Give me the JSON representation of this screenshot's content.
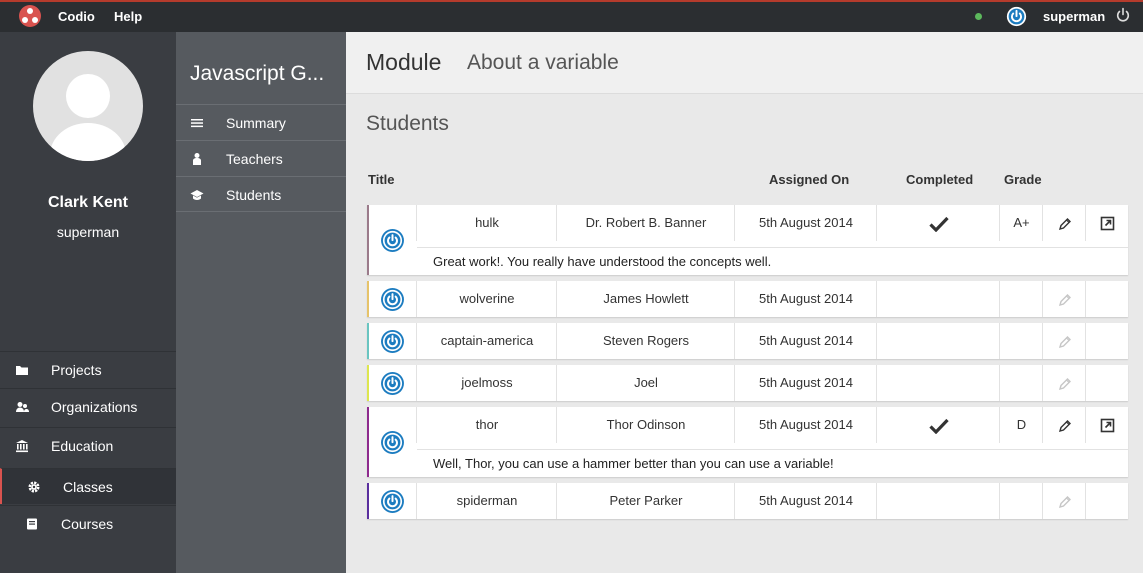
{
  "topbar": {
    "menu": [
      "Codio",
      "Help"
    ],
    "username": "superman",
    "accent": "#d9534f"
  },
  "profile": {
    "name": "Clark Kent",
    "username": "superman"
  },
  "sidebar": {
    "items": [
      {
        "label": "Projects",
        "icon": "folder-icon"
      },
      {
        "label": "Organizations",
        "icon": "users-icon"
      },
      {
        "label": "Education",
        "icon": "bank-icon"
      },
      {
        "label": "Classes",
        "icon": "gear-icon",
        "active": true
      },
      {
        "label": "Courses",
        "icon": "book-icon"
      }
    ]
  },
  "subnav": {
    "title": "Javascript G...",
    "items": [
      {
        "label": "Summary",
        "icon": "list-icon"
      },
      {
        "label": "Teachers",
        "icon": "teacher-icon"
      },
      {
        "label": "Students",
        "icon": "graduation-cap-icon"
      }
    ]
  },
  "main": {
    "module_label": "Module",
    "module_name": "About a variable",
    "section_title": "Students",
    "columns": {
      "title": "Title",
      "assigned": "Assigned On",
      "completed": "Completed",
      "grade": "Grade"
    },
    "rows": [
      {
        "username": "hulk",
        "name": "Dr. Robert B. Banner",
        "date": "5th August 2014",
        "completed": true,
        "grade": "A+",
        "color": "#9b7b8b",
        "comment": "Great work!. You really have understood the concepts well."
      },
      {
        "username": "wolverine",
        "name": "James Howlett",
        "date": "5th August 2014",
        "completed": false,
        "grade": "",
        "color": "#e6c36a",
        "comment": ""
      },
      {
        "username": "captain-america",
        "name": "Steven Rogers",
        "date": "5th August 2014",
        "completed": false,
        "grade": "",
        "color": "#6ac5c1",
        "comment": ""
      },
      {
        "username": "joelmoss",
        "name": "Joel",
        "date": "5th August 2014",
        "completed": false,
        "grade": "",
        "color": "#dde64f",
        "comment": ""
      },
      {
        "username": "thor",
        "name": "Thor Odinson",
        "date": "5th August 2014",
        "completed": true,
        "grade": "D",
        "color": "#8e2b8e",
        "comment": "Well, Thor, you can use a hammer better than you can use a variable!"
      },
      {
        "username": "spiderman",
        "name": "Peter Parker",
        "date": "5th August 2014",
        "completed": false,
        "grade": "",
        "color": "#5a2f9e",
        "comment": ""
      }
    ]
  }
}
